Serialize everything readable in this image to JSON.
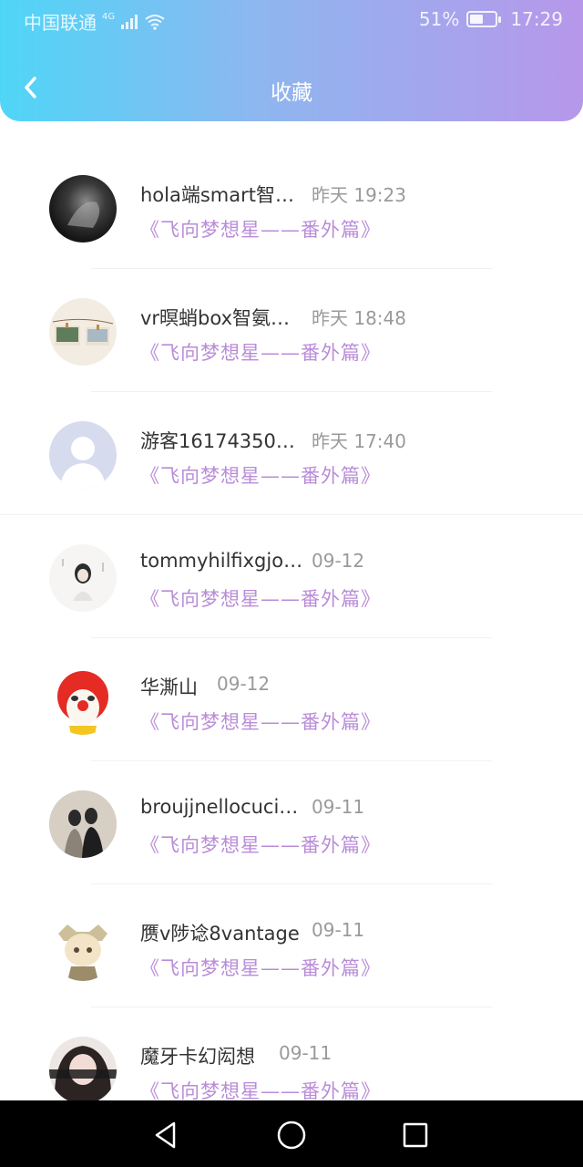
{
  "status_bar": {
    "carrier": "中国联通",
    "network": "4G",
    "battery": "51%",
    "battery_level": 0.51,
    "time": "17:29"
  },
  "header": {
    "title": "收藏",
    "back_icon": "chevron-left-icon"
  },
  "colors": {
    "header_gradient": [
      "#4fd6f7",
      "#8eb6ef",
      "#b797ea"
    ],
    "work_title": "#b98cd8",
    "time": "#9a9a9a"
  },
  "favorites": [
    {
      "name": "hola端smart智…",
      "time": "昨天 19:23",
      "work": "《飞向梦想星——番外篇》",
      "avatar": "avatar-dark-photo"
    },
    {
      "name": "vr暝蛸box智氨…",
      "time": "昨天 18:48",
      "work": "《飞向梦想星——番外篇》",
      "avatar": "avatar-polaroid-photos"
    },
    {
      "name": "游客16174350…",
      "time": "昨天 17:40",
      "work": "《飞向梦想星——番外篇》",
      "avatar": "avatar-default-user"
    },
    {
      "name": "tommyhilfixgjo…",
      "time": "09-12",
      "work": "《飞向梦想星——番外篇》",
      "avatar": "avatar-girl-illustration"
    },
    {
      "name": "华澌山",
      "time": "09-12",
      "work": "《飞向梦想星——番外篇》",
      "avatar": "avatar-clown-cartoon"
    },
    {
      "name": "broujjnellocuci…",
      "time": "09-11",
      "work": "《飞向梦想星——番外篇》",
      "avatar": "avatar-couple-photo"
    },
    {
      "name": "赝v陟谂8vantage",
      "time": "09-11",
      "work": "《飞向梦想星——番外篇》",
      "avatar": "avatar-anime-character"
    },
    {
      "name": "魔牙卡幻闳想",
      "time": "09-11",
      "work": "《飞向梦想星——番外篇》",
      "avatar": "avatar-girl-photo"
    }
  ],
  "nav_bar": {
    "back_icon": "triangle-back-icon",
    "home_icon": "circle-home-icon",
    "recents_icon": "square-recents-icon"
  }
}
